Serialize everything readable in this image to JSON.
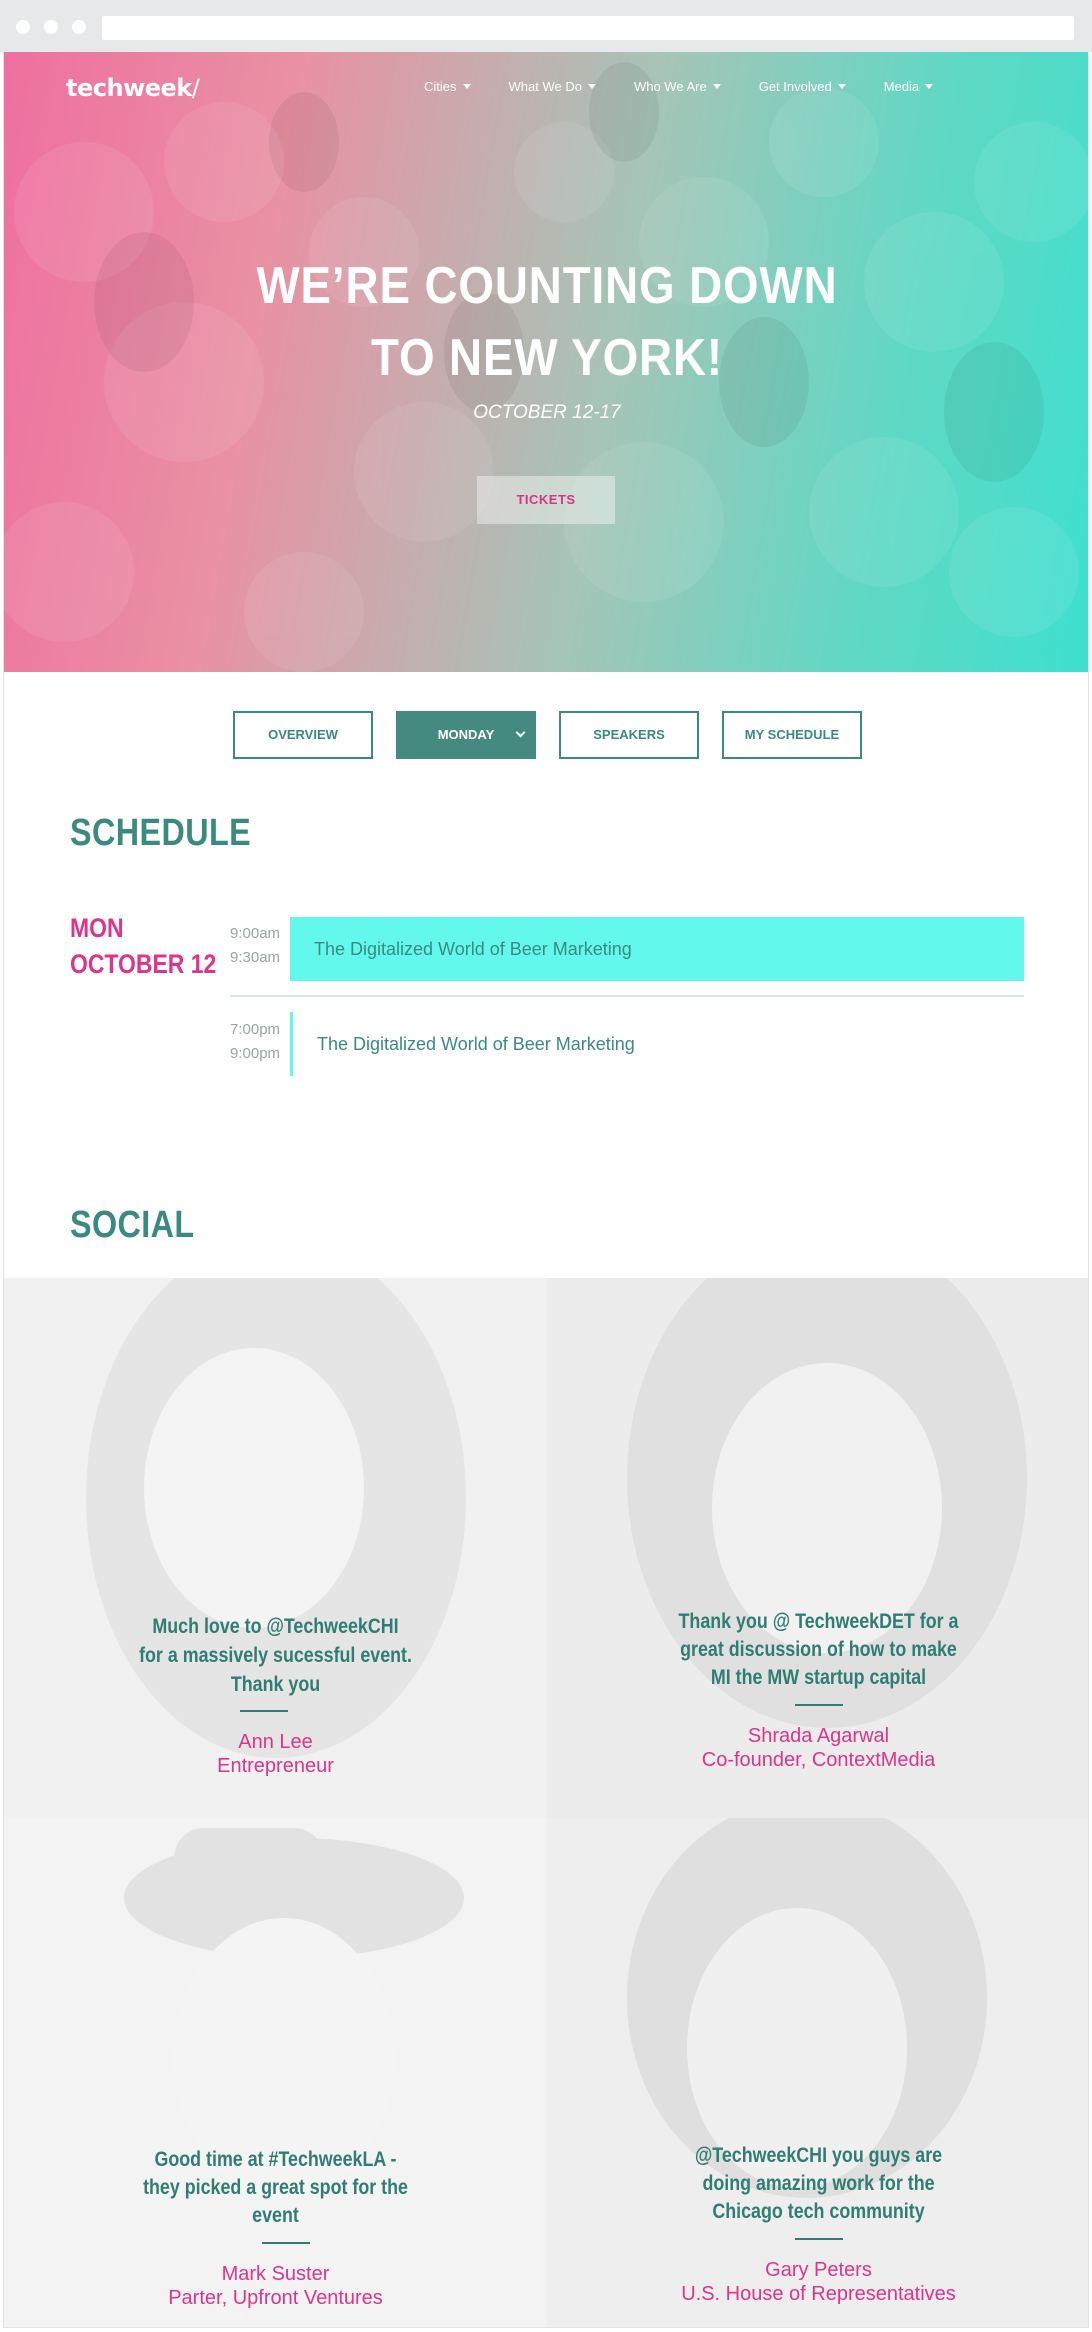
{
  "brand": {
    "logo": "techweek"
  },
  "nav": {
    "items": [
      {
        "label": "Cities"
      },
      {
        "label": "What We Do"
      },
      {
        "label": "Who We Are"
      },
      {
        "label": "Get Involved"
      },
      {
        "label": "Media"
      }
    ]
  },
  "hero": {
    "title_line1": "WE’RE COUNTING DOWN",
    "title_line2": "TO NEW YORK!",
    "date": "OCTOBER 12-17",
    "cta": "TICKETS"
  },
  "tabs": [
    {
      "label": "OVERVIEW"
    },
    {
      "label": "MONDAY"
    },
    {
      "label": "SPEAKERS"
    },
    {
      "label": "MY SCHEDULE"
    }
  ],
  "schedule": {
    "heading": "SCHEDULE",
    "day_line1": "MON",
    "day_line2": "OCTOBER 12",
    "events": [
      {
        "start": "9:00am",
        "end": "9:30am",
        "title": "The Digitalized World of Beer Marketing"
      },
      {
        "start": "7:00pm",
        "end": "9:00pm",
        "title": "The Digitalized World of Beer Marketing"
      }
    ]
  },
  "social": {
    "heading": "SOCIAL",
    "testimonials": [
      {
        "quote_l1": "Much love to @TechweekCHI",
        "quote_l2": "for a massively sucessful event.",
        "quote_l3": "Thank you",
        "name": "Ann Lee",
        "role": "Entrepreneur"
      },
      {
        "quote_l1": "Thank you @ TechweekDET for a",
        "quote_l2": "great discussion of how to make",
        "quote_l3": "MI the MW startup capital",
        "name": "Shrada Agarwal",
        "role": "Co-founder, ContextMedia"
      },
      {
        "quote_l1": "Good time at #TechweekLA -",
        "quote_l2": "they picked a great spot for the",
        "quote_l3": "event",
        "name": "Mark Suster",
        "role": "Parter, Upfront Ventures"
      },
      {
        "quote_l1": "@TechweekCHI you guys are",
        "quote_l2": "doing amazing work for the",
        "quote_l3": "Chicago tech community",
        "name": "Gary Peters",
        "role": "U.S. House of Representatives"
      }
    ]
  },
  "colors": {
    "teal": "#3a8a80",
    "pink": "#e0338a",
    "aqua": "#62f8ec"
  }
}
